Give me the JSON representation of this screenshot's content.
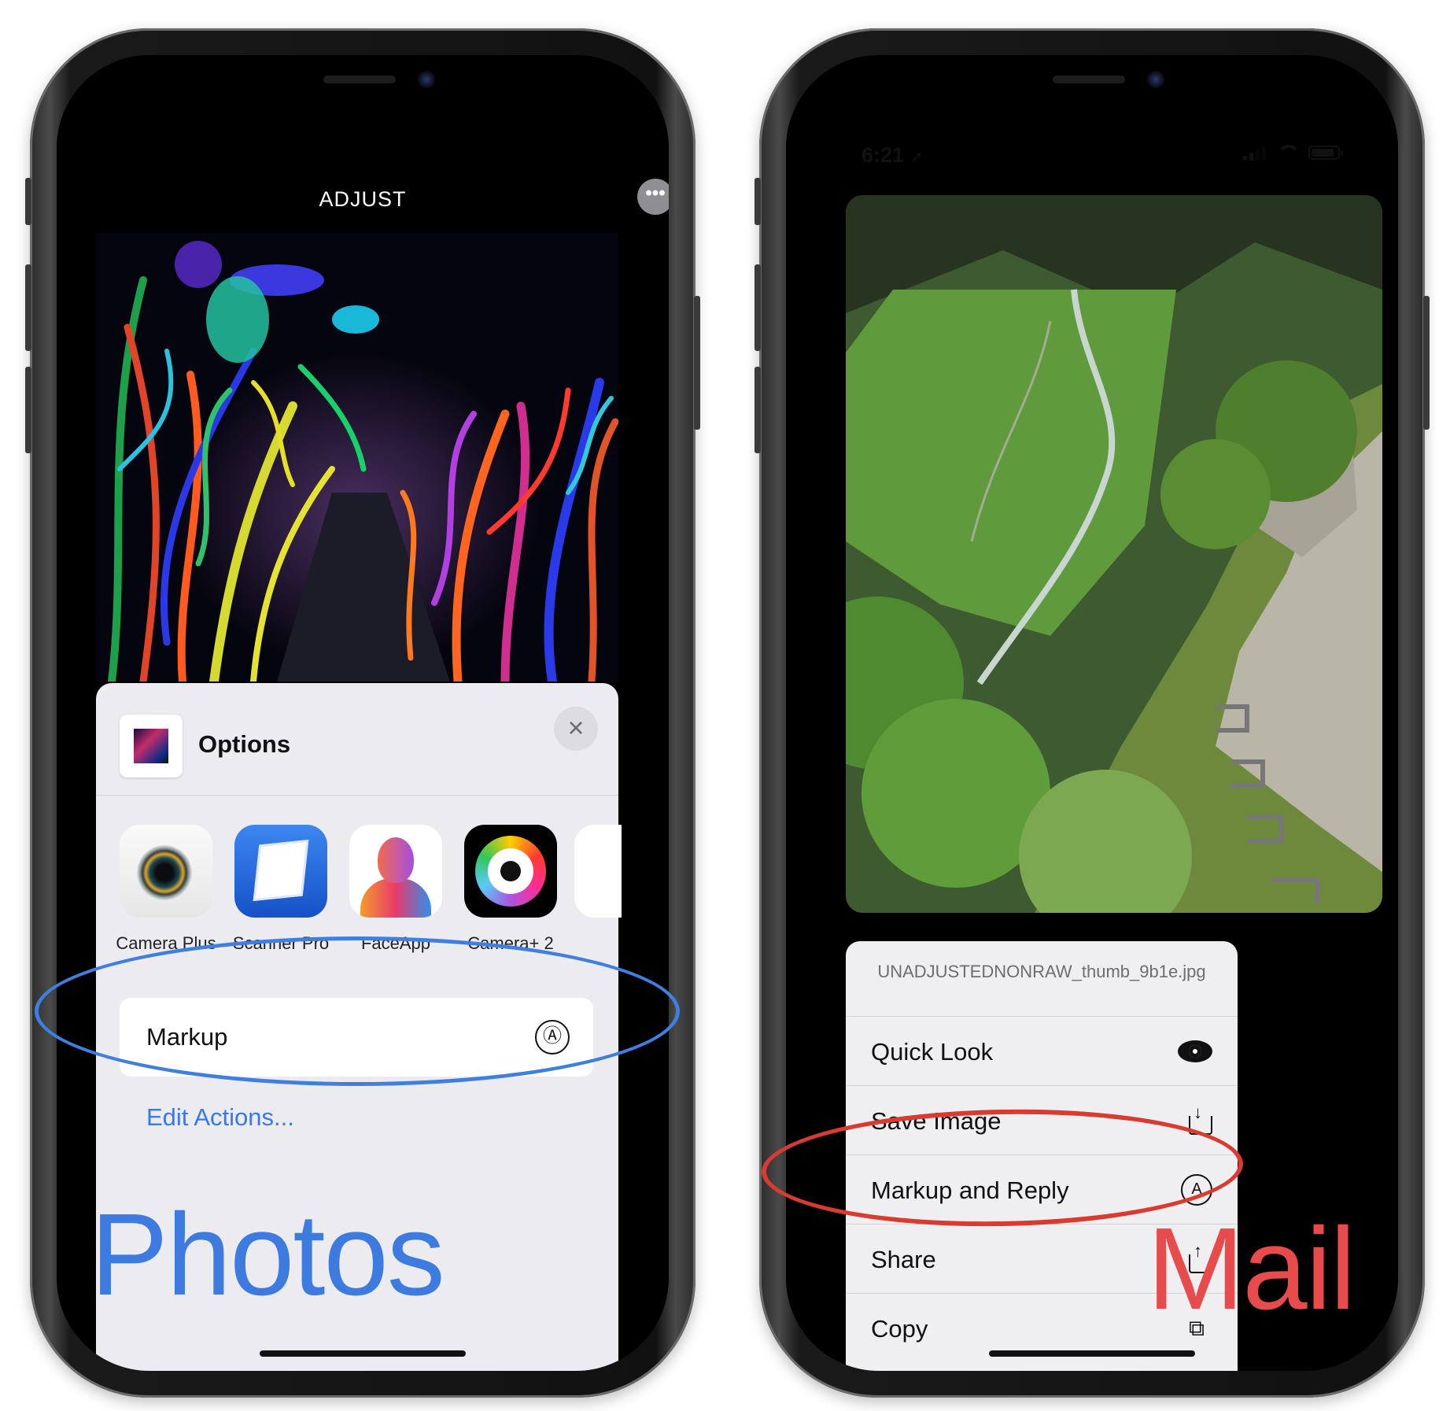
{
  "left_phone": {
    "header_title": "ADJUST",
    "more_icon": "ellipsis-icon",
    "sheet": {
      "title": "Options",
      "close_icon": "close-icon",
      "apps": [
        {
          "label": "Camera Plus",
          "icon": "camera-plus-icon"
        },
        {
          "label": "Scanner Pro",
          "icon": "scanner-pro-icon"
        },
        {
          "label": "FaceApp",
          "icon": "faceapp-icon"
        },
        {
          "label": "Camera+ 2",
          "icon": "camera-plus-2-icon"
        }
      ],
      "markup_label": "Markup",
      "markup_icon": "markup-pen-icon",
      "edit_actions": "Edit Actions..."
    },
    "big_label": "Photos",
    "big_label_color": "#3d7be0"
  },
  "right_phone": {
    "status": {
      "time": "6:21",
      "location_icon": "location-arrow-icon"
    },
    "menu": {
      "filename": "UNADJUSTEDNONRAW_thumb_9b1e.jpg",
      "items": [
        {
          "label": "Quick Look",
          "icon": "eye-icon"
        },
        {
          "label": "Save Image",
          "icon": "save-download-icon"
        },
        {
          "label": "Markup and Reply",
          "icon": "markup-pen-icon"
        },
        {
          "label": "Share",
          "icon": "share-icon"
        },
        {
          "label": "Copy",
          "icon": "copy-icon"
        }
      ]
    },
    "big_label": "Mail",
    "big_label_color": "#e84b4b"
  },
  "annotations": {
    "blue_ellipse_color": "#3f7fe0",
    "red_ellipse_color": "#d93b30"
  }
}
